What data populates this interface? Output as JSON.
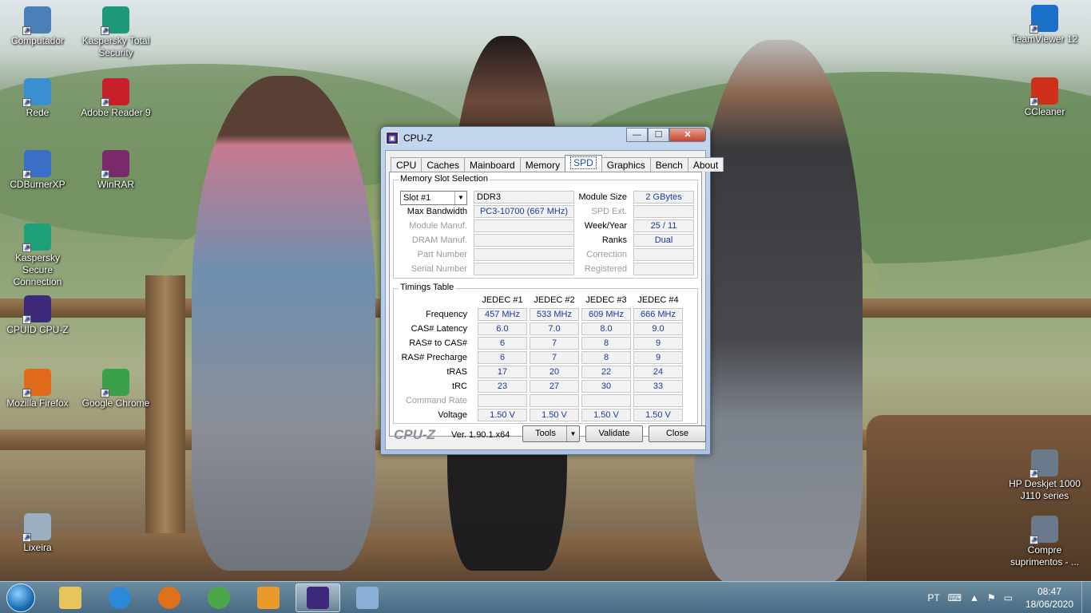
{
  "desktop_icons": [
    {
      "label": "Computador",
      "icon": "computer-icon"
    },
    {
      "label": "Kaspersky Total Security",
      "icon": "kaspersky-icon"
    },
    {
      "label": "Rede",
      "icon": "network-icon"
    },
    {
      "label": "Adobe Reader 9",
      "icon": "adobe-reader-icon"
    },
    {
      "label": "CDBurnerXP",
      "icon": "cdburner-icon"
    },
    {
      "label": "WinRAR",
      "icon": "winrar-icon"
    },
    {
      "label": "Kaspersky Secure Connection",
      "icon": "kaspersky-vpn-icon"
    },
    {
      "label": "CPUID CPU-Z",
      "icon": "cpuz-icon"
    },
    {
      "label": "Mozilla Firefox",
      "icon": "firefox-icon"
    },
    {
      "label": "Google Chrome",
      "icon": "chrome-icon"
    },
    {
      "label": "Lixeira",
      "icon": "recycle-bin-icon"
    },
    {
      "label": "TeamViewer 12",
      "icon": "teamviewer-icon"
    },
    {
      "label": "CCleaner",
      "icon": "ccleaner-icon"
    },
    {
      "label": "HP Deskjet 1000 J110 series",
      "icon": "printer-icon"
    },
    {
      "label": "Compre suprimentos - ...",
      "icon": "printer-supplies-icon"
    }
  ],
  "window": {
    "title": "CPU-Z",
    "tabs": [
      "CPU",
      "Caches",
      "Mainboard",
      "Memory",
      "SPD",
      "Graphics",
      "Bench",
      "About"
    ],
    "active_tab": "SPD",
    "slot_group_title": "Memory Slot Selection",
    "slot_selected": "Slot #1",
    "memory_type": "DDR3",
    "labels": {
      "max_bandwidth": "Max Bandwidth",
      "module_manuf": "Module Manuf.",
      "dram_manuf": "DRAM Manuf.",
      "part_number": "Part Number",
      "serial_number": "Serial Number",
      "module_size": "Module Size",
      "spd_ext": "SPD Ext.",
      "week_year": "Week/Year",
      "ranks": "Ranks",
      "correction": "Correction",
      "registered": "Registered"
    },
    "values": {
      "max_bandwidth": "PC3-10700 (667 MHz)",
      "module_manuf": "",
      "dram_manuf": "",
      "part_number": "",
      "serial_number": "",
      "module_size": "2 GBytes",
      "spd_ext": "",
      "week_year": "25 / 11",
      "ranks": "Dual",
      "correction": "",
      "registered": ""
    },
    "timings": {
      "title": "Timings Table",
      "columns": [
        "JEDEC #1",
        "JEDEC #2",
        "JEDEC #3",
        "JEDEC #4"
      ],
      "rows": [
        {
          "label": "Frequency",
          "values": [
            "457 MHz",
            "533 MHz",
            "609 MHz",
            "666 MHz"
          ]
        },
        {
          "label": "CAS# Latency",
          "values": [
            "6.0",
            "7.0",
            "8.0",
            "9.0"
          ]
        },
        {
          "label": "RAS# to CAS#",
          "values": [
            "6",
            "7",
            "8",
            "9"
          ]
        },
        {
          "label": "RAS# Precharge",
          "values": [
            "6",
            "7",
            "8",
            "9"
          ]
        },
        {
          "label": "tRAS",
          "values": [
            "17",
            "20",
            "22",
            "24"
          ]
        },
        {
          "label": "tRC",
          "values": [
            "23",
            "27",
            "30",
            "33"
          ]
        },
        {
          "label": "Command Rate",
          "values": [
            "",
            "",
            "",
            ""
          ]
        },
        {
          "label": "Voltage",
          "values": [
            "1.50 V",
            "1.50 V",
            "1.50 V",
            "1.50 V"
          ]
        }
      ]
    },
    "footer": {
      "logo": "CPU-Z",
      "version": "Ver. 1.90.1.x64",
      "tools": "Tools",
      "validate": "Validate",
      "close": "Close"
    }
  },
  "taskbar": {
    "apps": [
      "explorer-icon",
      "internet-explorer-icon",
      "firefox-icon",
      "chrome-icon",
      "media-player-icon",
      "cpuz-icon",
      "paint-icon"
    ],
    "active_app": "cpuz-icon",
    "language": "PT",
    "time": "08:47",
    "date": "18/06/2020"
  }
}
